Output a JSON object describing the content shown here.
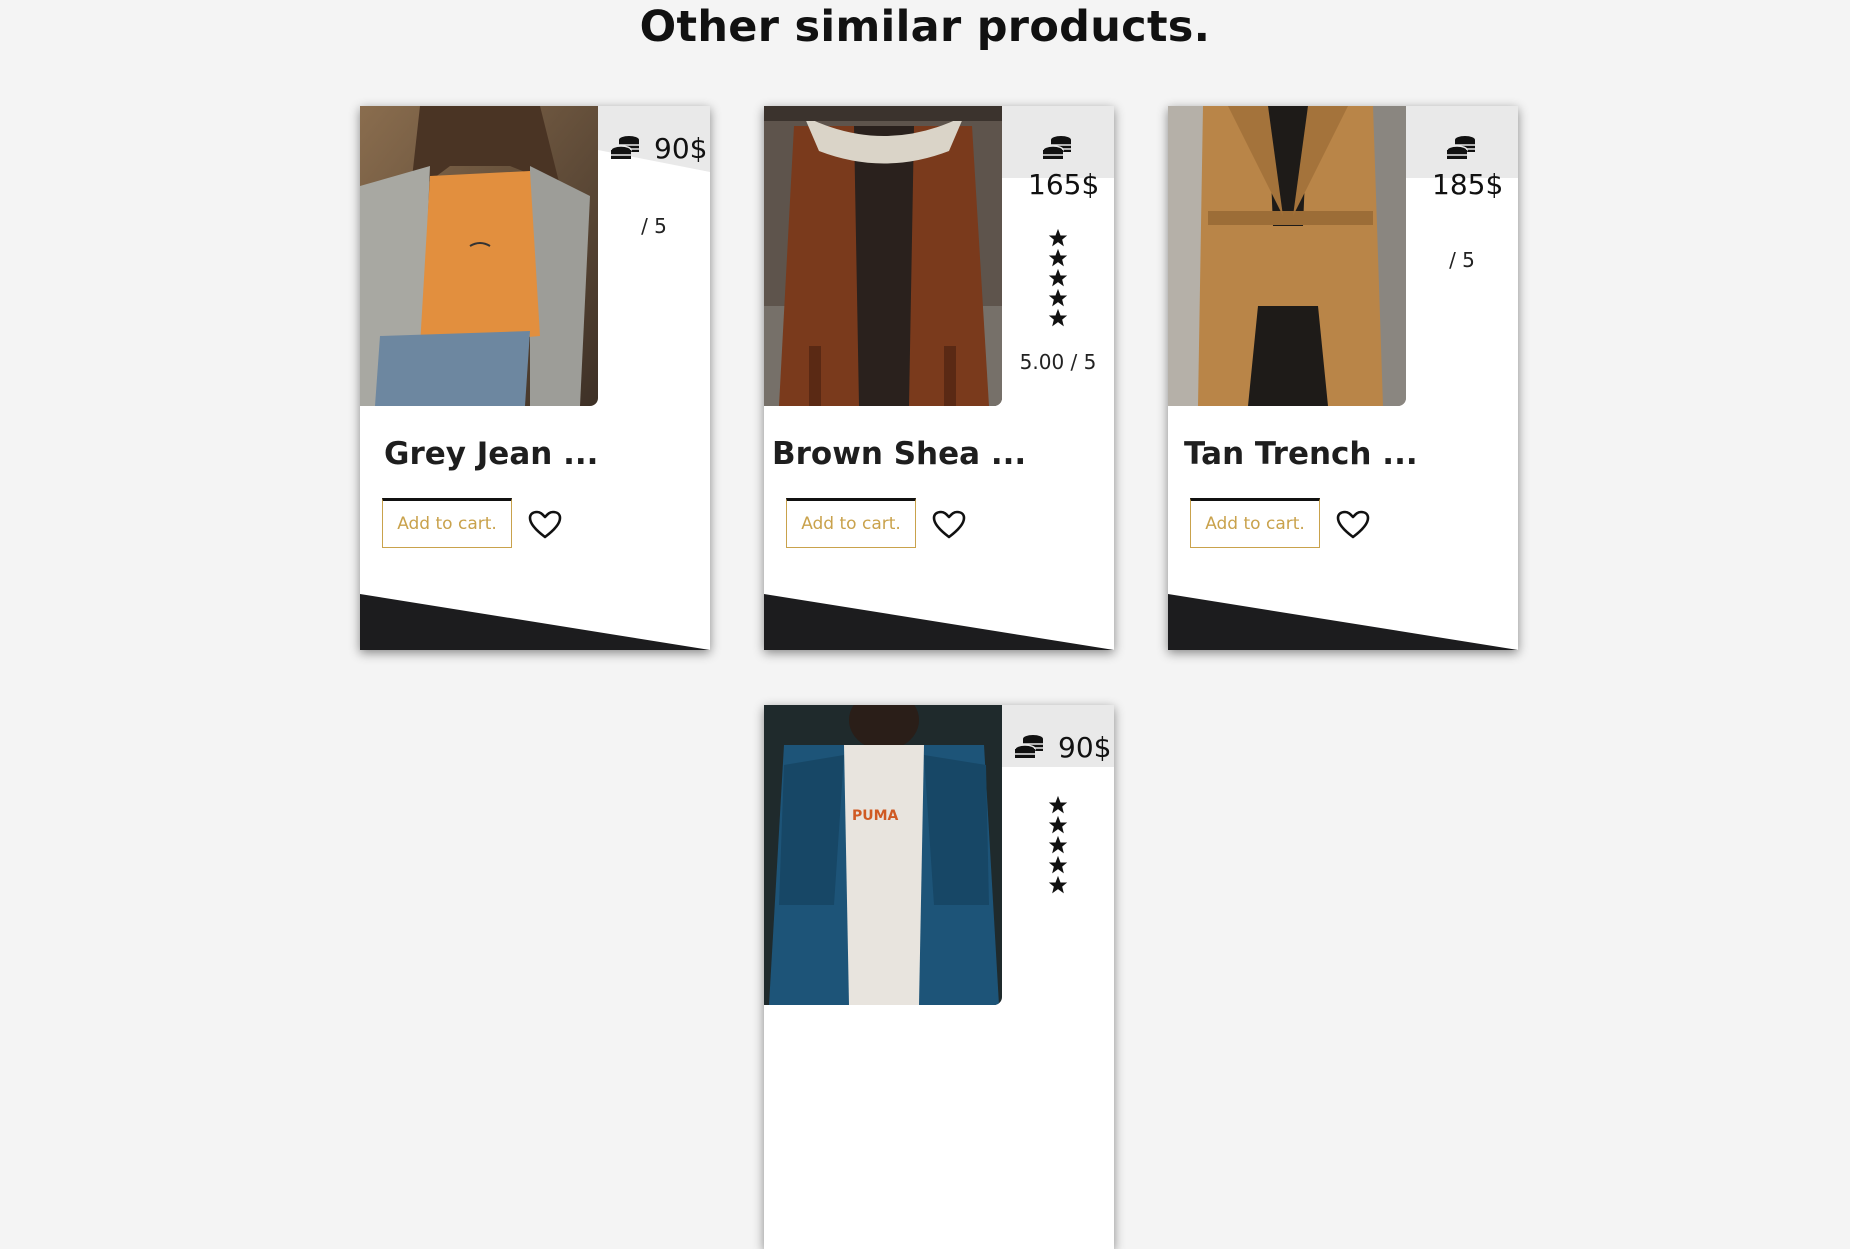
{
  "section": {
    "heading": "Other similar products."
  },
  "products": [
    {
      "title": "Grey Jean ...",
      "price": "90$",
      "rating": "/ 5",
      "stars": 0,
      "cart_label": "Add to cart.",
      "photo": "woman-grey-jean-jacket"
    },
    {
      "title": "Brown Shea ...",
      "price": "165$",
      "rating": "5.00 / 5",
      "stars": 5,
      "cart_label": "Add to cart.",
      "photo": "man-brown-shearling-jacket"
    },
    {
      "title": "Tan Trench ...",
      "price": "185$",
      "rating": "/ 5",
      "stars": 0,
      "cart_label": "Add to cart.",
      "photo": "woman-tan-trench-coat"
    },
    {
      "title": "",
      "price": "90$",
      "rating": "",
      "stars": 5,
      "cart_label": "",
      "photo": "man-blue-denim-jacket"
    }
  ],
  "icons": {
    "price": "coins-icon",
    "rating": "star-icon",
    "favorite": "heart-icon"
  },
  "colors": {
    "accent": "#c9a24c",
    "dark": "#1c1c1e",
    "background": "#f4f4f4"
  }
}
